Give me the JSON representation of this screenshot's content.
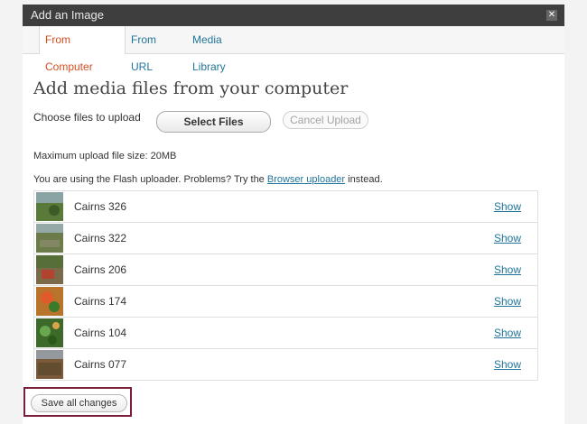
{
  "window": {
    "title": "Add an Image",
    "close_glyph": "✕"
  },
  "tabs": [
    {
      "label": "From Computer",
      "active": true
    },
    {
      "label": "From URL",
      "active": false
    },
    {
      "label": "Media Library",
      "active": false
    }
  ],
  "upload": {
    "heading": "Add media files from your computer",
    "choose_label": "Choose files to upload",
    "select_button": "Select Files",
    "cancel_button": "Cancel Upload",
    "max_size": "Maximum upload file size: 20MB",
    "flash_note_prefix": "You are using the Flash uploader. Problems? Try the",
    "flash_note_link": "Browser uploader",
    "flash_note_suffix": "instead."
  },
  "media_items": [
    {
      "name": "Cairns 326",
      "action": "Show",
      "thumb_color": "#5a7a3a"
    },
    {
      "name": "Cairns 322",
      "action": "Show",
      "thumb_color": "#6b7c4a"
    },
    {
      "name": "Cairns 206",
      "action": "Show",
      "thumb_color": "#7a6a4a"
    },
    {
      "name": "Cairns 174",
      "action": "Show",
      "thumb_color": "#b8742a"
    },
    {
      "name": "Cairns 104",
      "action": "Show",
      "thumb_color": "#3d6a2a"
    },
    {
      "name": "Cairns 077",
      "action": "Show",
      "thumb_color": "#7a5a3a"
    }
  ],
  "footer": {
    "save_button": "Save all changes"
  },
  "colors": {
    "accent_link": "#21759b",
    "active_tab": "#d54e21",
    "highlight_border": "#7a1f38",
    "titlebar": "#3e3e3e"
  }
}
